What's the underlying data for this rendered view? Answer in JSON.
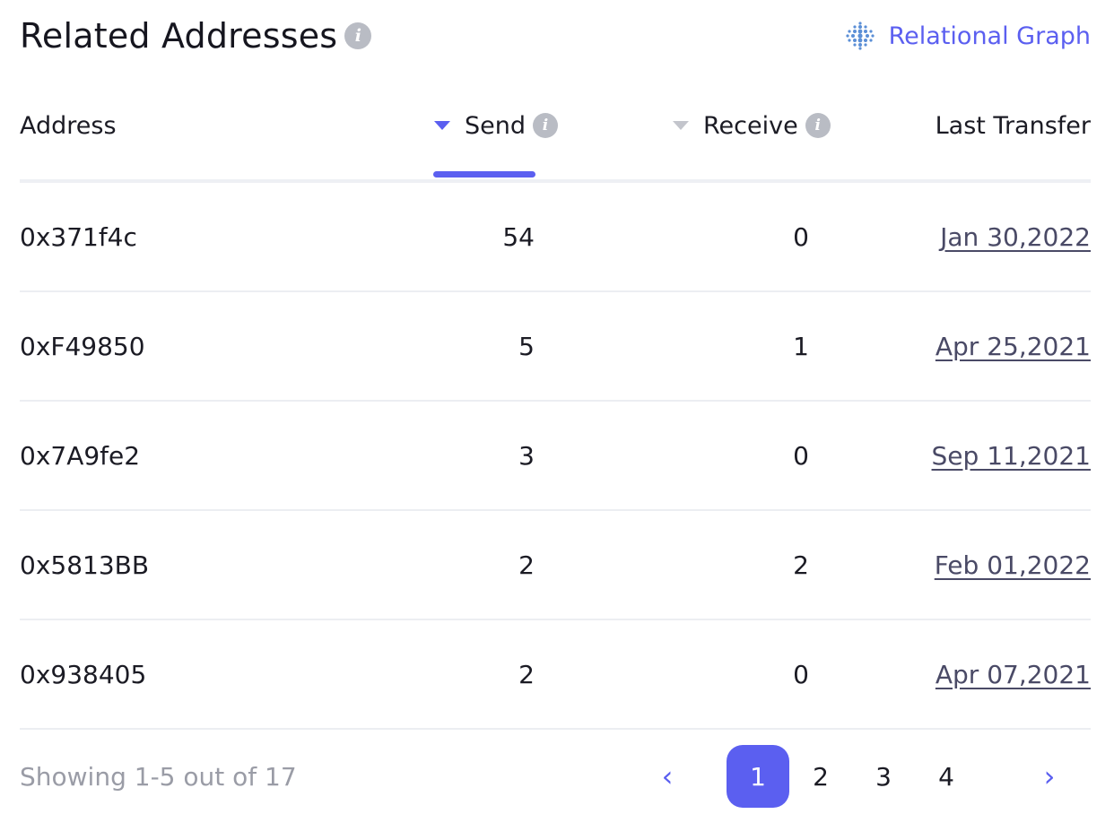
{
  "header": {
    "title": "Related Addresses",
    "info_icon": "info-icon",
    "graph_link_label": "Relational Graph",
    "graph_icon": "dot-grid-icon"
  },
  "table": {
    "columns": {
      "address": "Address",
      "send": "Send",
      "receive": "Receive",
      "last_transfer": "Last Transfer"
    },
    "sort": {
      "column": "send",
      "direction": "desc"
    },
    "rows": [
      {
        "address": "0x371f4c",
        "send": "54",
        "receive": "0",
        "last_transfer": "Jan 30,2022"
      },
      {
        "address": "0xF49850",
        "send": "5",
        "receive": "1",
        "last_transfer": "Apr 25,2021"
      },
      {
        "address": "0x7A9fe2",
        "send": "3",
        "receive": "0",
        "last_transfer": "Sep 11,2021"
      },
      {
        "address": "0x5813BB",
        "send": "2",
        "receive": "2",
        "last_transfer": "Feb 01,2022"
      },
      {
        "address": "0x938405",
        "send": "2",
        "receive": "0",
        "last_transfer": "Apr 07,2021"
      }
    ]
  },
  "footer": {
    "showing": "Showing 1-5 out of 17",
    "pages": [
      "1",
      "2",
      "3",
      "4"
    ],
    "current_page": "1",
    "prev_icon": "chevron-left-icon",
    "next_icon": "chevron-right-icon"
  },
  "colors": {
    "accent": "#5b5ff0",
    "text": "#1b1b24",
    "muted": "#9a9ca6",
    "link": "#4a4a66",
    "divider": "#eceef2"
  }
}
